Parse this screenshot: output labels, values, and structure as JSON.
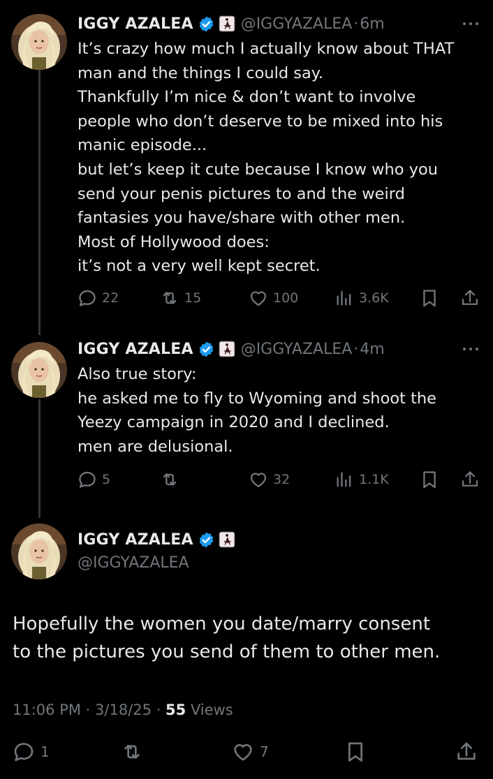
{
  "author": {
    "name": "IGGY AZALEA",
    "handle": "@IGGYAZALEA"
  },
  "colors": {
    "background": "#000000",
    "text": "#e7e9ea",
    "muted": "#71767b",
    "verified": "#1d9bf0",
    "thread_line": "#333639"
  },
  "thread": [
    {
      "time": "6m",
      "lines": [
        "It’s crazy how much I actually know about THAT",
        "man and the things I could say.",
        "Thankfully I’m nice & don’t want to involve",
        "people who don’t deserve to be mixed into his",
        "manic episode...",
        "but let’s keep it cute because I know who you",
        "send your penis pictures to and the weird",
        "fantasies you have/share with other men.",
        "Most of Hollywood does:",
        "it’s not a very well kept secret."
      ],
      "replies": "22",
      "reposts": "15",
      "likes": "100",
      "views": "3.6K"
    },
    {
      "time": "4m",
      "lines": [
        "Also true story:",
        "he asked me to fly to Wyoming and shoot the",
        "Yeezy campaign in 2020 and I declined.",
        "men are delusional."
      ],
      "replies": "5",
      "reposts": "",
      "likes": "32",
      "views": "1.1K"
    }
  ],
  "main_tweet": {
    "lines": [
      "Hopefully the women you date/marry consent",
      "to the pictures you send of them to other men."
    ],
    "timestamp": "11:06 PM",
    "date": "3/18/25",
    "views_count": "55",
    "views_label": "Views",
    "replies": "1",
    "reposts": "",
    "likes": "7"
  },
  "icons": {
    "verified": "verified-badge-icon",
    "affiliate": "affiliate-logo-icon",
    "more": "more-dots-icon",
    "reply": "reply-icon",
    "repost": "repost-icon",
    "like": "heart-icon",
    "views": "views-chart-icon",
    "bookmark": "bookmark-icon",
    "share": "share-icon"
  }
}
